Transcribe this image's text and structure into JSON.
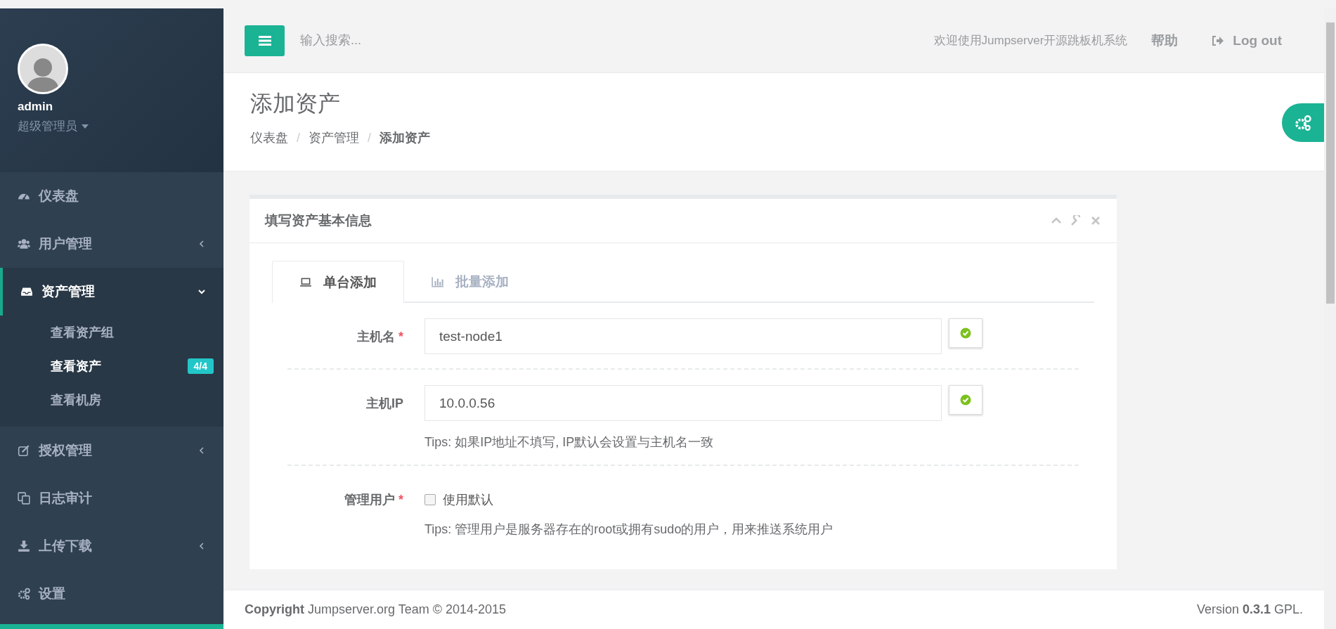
{
  "profile": {
    "name": "admin",
    "role": "超级管理员"
  },
  "sidebar": {
    "items": [
      {
        "label": "仪表盘",
        "has_arrow": false,
        "expanded": false
      },
      {
        "label": "用户管理",
        "has_arrow": true,
        "expanded": false
      },
      {
        "label": "资产管理",
        "has_arrow": true,
        "expanded": true,
        "children": [
          {
            "label": "查看资产组",
            "selected": false
          },
          {
            "label": "查看资产",
            "selected": true,
            "badge": "4/4"
          },
          {
            "label": "查看机房",
            "selected": false
          }
        ]
      },
      {
        "label": "授权管理",
        "has_arrow": true,
        "expanded": false
      },
      {
        "label": "日志审计",
        "has_arrow": false,
        "expanded": false
      },
      {
        "label": "上传下载",
        "has_arrow": true,
        "expanded": false
      },
      {
        "label": "设置",
        "has_arrow": false,
        "expanded": false
      }
    ]
  },
  "header": {
    "search_placeholder": "输入搜索...",
    "welcome": "欢迎使用Jumpserver开源跳板机系统",
    "help": "帮助",
    "logout": "Log out"
  },
  "page": {
    "title": "添加资产",
    "breadcrumb_separator": "/",
    "breadcrumb": [
      {
        "label": "仪表盘",
        "selected": false
      },
      {
        "label": "资产管理",
        "selected": false
      },
      {
        "label": "添加资产",
        "selected": true
      }
    ]
  },
  "card": {
    "title": "填写资产基本信息",
    "tabs": [
      {
        "label": "单台添加",
        "selected": true
      },
      {
        "label": "批量添加",
        "selected": false
      }
    ],
    "fields": [
      {
        "kind": "text",
        "label": "主机名",
        "required_mark": "*",
        "value": "test-node1",
        "valid": true
      },
      {
        "kind": "text",
        "label": "主机IP",
        "value": "10.0.0.56",
        "valid": true,
        "tip": "Tips: 如果IP地址不填写, IP默认会设置与主机名一致"
      },
      {
        "kind": "checkbox",
        "label": "管理用户",
        "required_mark": "*",
        "option": "使用默认",
        "checked": false,
        "tip": "Tips: 管理用户是服务器存在的root或拥有sudo的用户，用来推送系统用户"
      }
    ]
  },
  "footer": {
    "copyright": "**Copyright** Jumpserver.org Team © 2014-2015",
    "version": "Version **0.3.1** GPL."
  }
}
